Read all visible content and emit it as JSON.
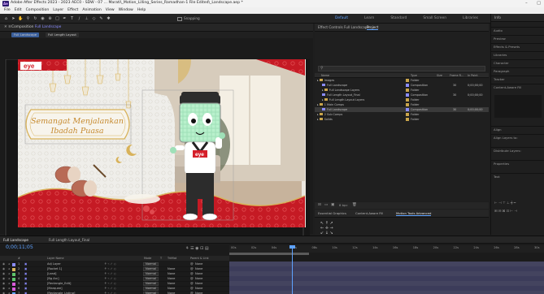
{
  "window": {
    "title": "Adobe After Effects 2023 - 2023 AEC0 - SDW - 07 ... Marati\\_Motion_Lilling_Series_Ramadhan-1 File Edited\\_Landscape.aep *",
    "minimize": "–",
    "maximize": "□"
  },
  "menu": [
    "File",
    "Edit",
    "Composition",
    "Layer",
    "Effect",
    "Animation",
    "View",
    "Window",
    "Help"
  ],
  "toolbar": {
    "snapping_label": "Snapping",
    "workspaces": [
      "Default",
      "Learn",
      "Standard",
      "Small Screen",
      "Libraries"
    ],
    "active_workspace_index": 0
  },
  "composition_panel": {
    "tab_prefix": "Composition",
    "comp_name": "Full Landscape",
    "chips": [
      "Full Landscape",
      "Full Length Layout"
    ],
    "bottom": {
      "zoom": "Full",
      "resolution": "Full",
      "camera": "Active Camera",
      "views": "1 View",
      "timecode": "0;00;11;05"
    }
  },
  "scene": {
    "brand_logo": "eye",
    "banner_line1": "Semangat Menjalankan",
    "banner_line2": "Ibadah Puasa",
    "shirt_logo": "eye"
  },
  "colors": {
    "brand_red": "#d51f2a",
    "gold": "#d8b25a",
    "accent_blue": "#5ea2ff",
    "comp_purple": "#8a8cff",
    "folder_yellow": "#c9a54b"
  },
  "project_panel": {
    "tabs": [
      "Effect Controls Full Landscape",
      "Project"
    ],
    "active_tab_index": 1,
    "search_icon": "search-icon",
    "columns": [
      "Name",
      "Type",
      "Size",
      "Frame R...",
      "In Point"
    ],
    "rows": [
      {
        "indent": 0,
        "icon": "folder",
        "name": "Images",
        "type": "Folder",
        "size": "",
        "fps": "",
        "in": "",
        "color": "#c9a54b",
        "selected": false
      },
      {
        "indent": 1,
        "icon": "comp",
        "name": "Full Landscape",
        "type": "Composition",
        "size": "",
        "fps": "30",
        "in": "0;00;00;00",
        "color": "#8a8cff",
        "selected": false
      },
      {
        "indent": 1,
        "icon": "folder",
        "name": "Full Landscape Layers",
        "type": "Folder",
        "size": "",
        "fps": "",
        "in": "",
        "color": "#c9a54b",
        "selected": false
      },
      {
        "indent": 1,
        "icon": "comp",
        "name": "Full Length Layout_Final",
        "type": "Composition",
        "size": "",
        "fps": "30",
        "in": "0;00;00;00",
        "color": "#8a8cff",
        "selected": false
      },
      {
        "indent": 1,
        "icon": "folder",
        "name": "Full Length Layout Layers",
        "type": "Folder",
        "size": "",
        "fps": "",
        "in": "",
        "color": "#c9a54b",
        "selected": false
      },
      {
        "indent": 0,
        "icon": "folder",
        "name": "1 Main Comps",
        "type": "Folder",
        "size": "",
        "fps": "",
        "in": "",
        "color": "#c9a54b",
        "selected": false
      },
      {
        "indent": 1,
        "icon": "comp",
        "name": "Full Landscape",
        "type": "Composition",
        "size": "",
        "fps": "30",
        "in": "0;00;00;00",
        "color": "#8a8cff",
        "selected": true
      },
      {
        "indent": 0,
        "icon": "folder",
        "name": "2 Sub Comps",
        "type": "Folder",
        "size": "",
        "fps": "",
        "in": "",
        "color": "#c9a54b",
        "selected": false
      },
      {
        "indent": 0,
        "icon": "folder",
        "name": "Solids",
        "type": "Folder",
        "size": "",
        "fps": "",
        "in": "",
        "color": "#c9a54b",
        "selected": false
      }
    ],
    "bpc": "8 bpc"
  },
  "controls_panel": {
    "tabs": [
      "Essential Graphics",
      "Content-Aware Fill",
      "Motion Tools Advanced"
    ],
    "active_tab_index": 2
  },
  "right_column": {
    "header": "Info",
    "items": [
      "Audio",
      "Preview",
      "Effects & Presets",
      "Libraries",
      "Character",
      "Paragraph",
      "Tracker",
      "Content-Aware Fill",
      "Align",
      "Align Layers to:",
      "Distribute Layers:",
      "Properties",
      "Text"
    ]
  },
  "timeline": {
    "tabs": [
      "Full Landscape",
      "Full Length Layout_Final"
    ],
    "active_tab_index": 0,
    "timecode": "0;00;11;05",
    "ruler_ticks": [
      "00s",
      "02s",
      "04s",
      "06s",
      "08s",
      "10s",
      "12s",
      "14s",
      "16s",
      "18s",
      "20s",
      "22s",
      "24s",
      "26s",
      "28s",
      "30s"
    ],
    "playhead_fraction": 0.198,
    "layer_columns": [
      "#",
      "Layer Name",
      "Mode",
      "T",
      "TrkMat",
      "Parent & Link"
    ],
    "layers": [
      {
        "num": "1",
        "name": "Adj Layer",
        "mode": "Normal",
        "trk": "",
        "parent": "None",
        "label": "#8a8cff"
      },
      {
        "num": "2",
        "name": "[Rocket 1]",
        "mode": "Normal",
        "trk": "None",
        "parent": "None",
        "label": "#d8b25a"
      },
      {
        "num": "3",
        "name": "[Lead]",
        "mode": "Normal",
        "trk": "None",
        "parent": "None",
        "label": "#5ec46a"
      },
      {
        "num": "4",
        "name": "[Bg Arc]",
        "mode": "Normal",
        "trk": "None",
        "parent": "None",
        "label": "#5ec46a"
      },
      {
        "num": "5",
        "name": "[Rectangle_Edit]",
        "mode": "Normal",
        "trk": "None",
        "parent": "None",
        "label": "#d85ad8"
      },
      {
        "num": "6",
        "name": "[Marquee]",
        "mode": "Normal",
        "trk": "None",
        "parent": "None",
        "label": "#d85ad8"
      },
      {
        "num": "7",
        "name": "[Rectangle_Listing]",
        "mode": "Normal",
        "trk": "None",
        "parent": "None",
        "label": "#5ea2ff"
      }
    ]
  }
}
